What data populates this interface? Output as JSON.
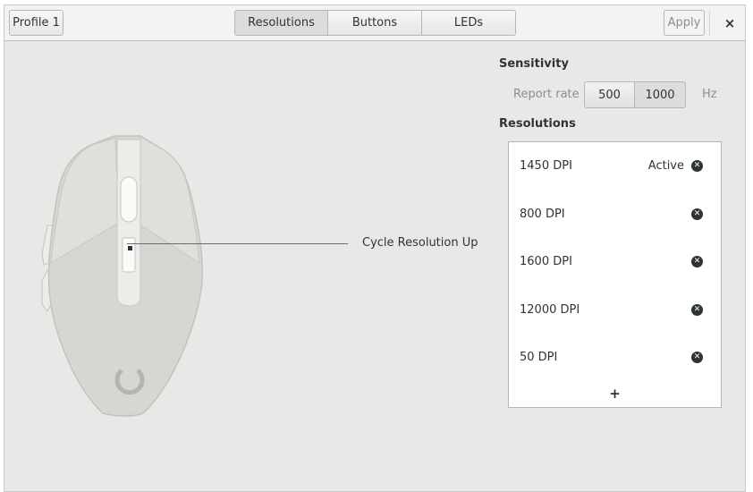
{
  "header": {
    "profile_label": "Profile 1",
    "tabs": [
      {
        "label": "Resolutions",
        "active": true
      },
      {
        "label": "Buttons",
        "active": false
      },
      {
        "label": "LEDs",
        "active": false
      }
    ],
    "apply_label": "Apply",
    "close_glyph": "×"
  },
  "sensitivity": {
    "heading": "Sensitivity",
    "report_rate_label": "Report rate",
    "rates": [
      "500",
      "1000"
    ],
    "selected_rate": "1000",
    "unit": "Hz"
  },
  "resolutions": {
    "heading": "Resolutions",
    "items": [
      {
        "label": "1450 DPI",
        "status": "Active"
      },
      {
        "label": "800 DPI",
        "status": ""
      },
      {
        "label": "1600 DPI",
        "status": ""
      },
      {
        "label": "12000 DPI",
        "status": ""
      },
      {
        "label": "50 DPI",
        "status": ""
      }
    ],
    "add_glyph": "+"
  },
  "mouse": {
    "callout": "Cycle Resolution Up"
  },
  "colors": {
    "background": "#e8e8e7",
    "headerbar": "#f3f3f2",
    "mouse_body": "#d6d6d3",
    "mouse_edge": "#bfbfbc",
    "text": "#2e3436",
    "dim_text": "#8b8e8f"
  }
}
